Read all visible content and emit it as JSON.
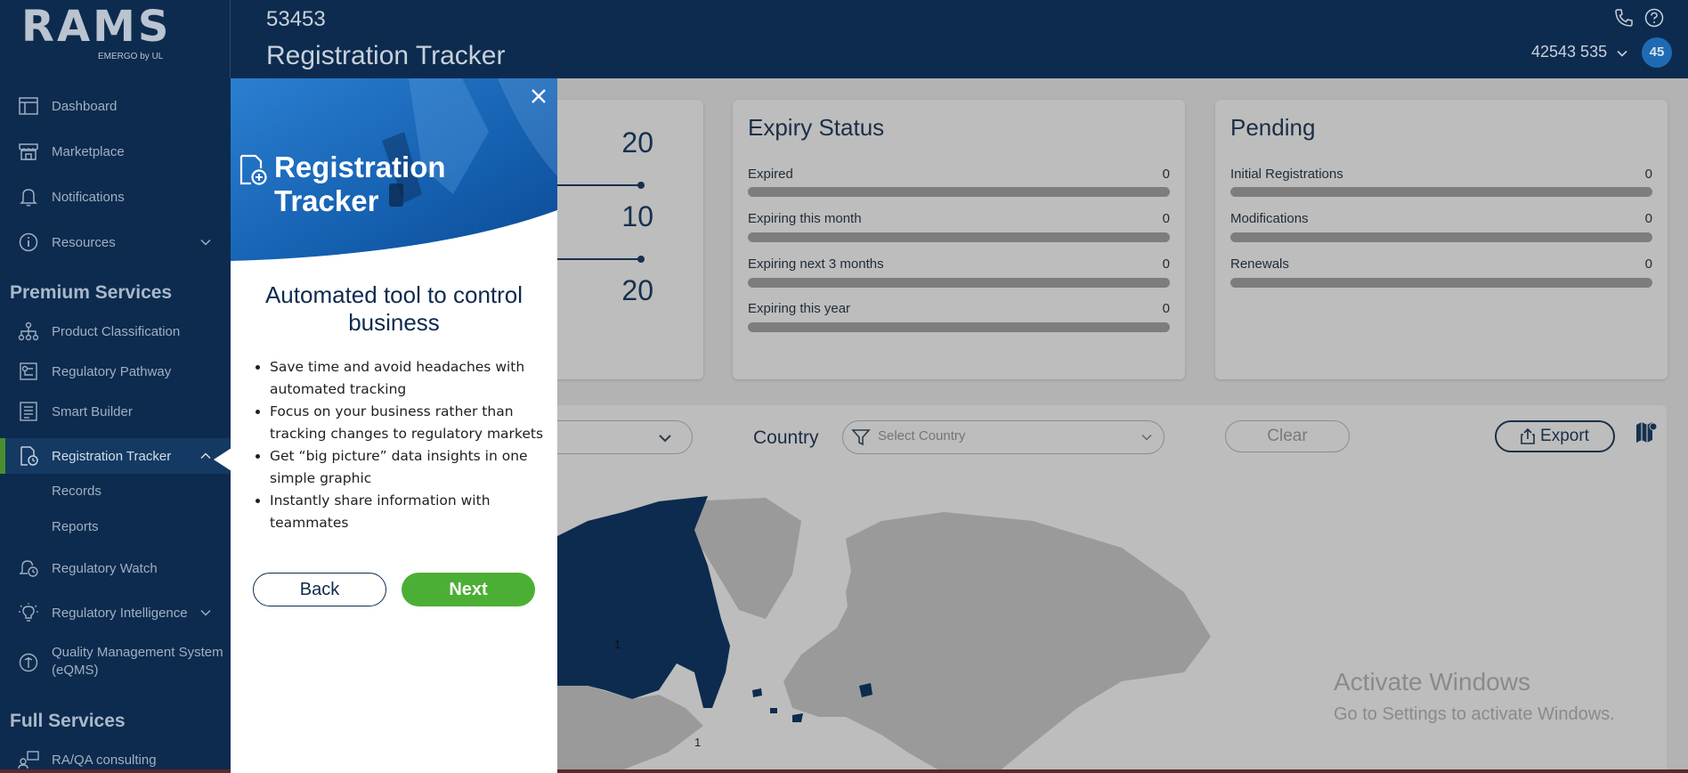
{
  "header": {
    "logo": "RAMS",
    "logo_sub": "EMERGO by UL",
    "record_id": "53453",
    "page_title": "Registration Tracker",
    "account_number": "42543 535",
    "avatar_initials": "45"
  },
  "sidebar": {
    "items": [
      {
        "label": "Dashboard",
        "icon": "dashboard-icon"
      },
      {
        "label": "Marketplace",
        "icon": "store-icon"
      },
      {
        "label": "Notifications",
        "icon": "bell-icon"
      },
      {
        "label": "Resources",
        "icon": "info-icon"
      }
    ],
    "premium_title": "Premium Services",
    "premium_items": [
      {
        "label": "Product Classification",
        "icon": "hierarchy-icon"
      },
      {
        "label": "Regulatory Pathway",
        "icon": "pathway-icon"
      },
      {
        "label": "Smart Builder",
        "icon": "builder-icon"
      },
      {
        "label": "Registration Tracker",
        "icon": "tracker-icon"
      }
    ],
    "tracker_subitems": [
      "Records",
      "Reports"
    ],
    "more_items": [
      {
        "label": "Regulatory Watch",
        "icon": "watch-bell-icon"
      },
      {
        "label": "Regulatory Intelligence",
        "icon": "lightbulb-icon"
      }
    ],
    "qms_line1": "Quality Management System",
    "qms_line2": "(eQMS)",
    "full_title": "Full Services",
    "full_items": [
      {
        "label": "RA/QA consulting",
        "icon": "consulting-icon"
      }
    ]
  },
  "cards": {
    "first": {
      "values": [
        "20",
        "10",
        "20"
      ]
    },
    "expiry": {
      "title": "Expiry Status",
      "rows": [
        {
          "label": "Expired",
          "value": "0"
        },
        {
          "label": "Expiring this month",
          "value": "0"
        },
        {
          "label": "Expiring next 3 months",
          "value": "0"
        },
        {
          "label": "Expiring this year",
          "value": "0"
        }
      ]
    },
    "pending": {
      "title": "Pending",
      "rows": [
        {
          "label": "Initial Registrations",
          "value": "0"
        },
        {
          "label": "Modifications",
          "value": "0"
        },
        {
          "label": "Renewals",
          "value": "0"
        }
      ]
    }
  },
  "filters": {
    "country_label": "Country",
    "country_placeholder": "Select Country",
    "clear_label": "Clear",
    "export_label": "Export"
  },
  "map": {
    "marker_label_1": "1",
    "marker_label_2": "1"
  },
  "watermark": {
    "line1": "Activate Windows",
    "line2": "Go to Settings to activate Windows."
  },
  "tour": {
    "banner_title": "Registration Tracker",
    "heading": "Automated tool to control business",
    "bullets": [
      "Save time and avoid headaches with automated tracking",
      "Focus on your business rather than tracking changes to regulatory markets",
      "Get “big picture” data insights in one simple graphic",
      "Instantly share information with teammates"
    ],
    "back_label": "Back",
    "next_label": "Next"
  },
  "colors": {
    "navy": "#0d2b4e",
    "accent_green": "#4caf35",
    "active_bar": "#4a8f2e"
  }
}
